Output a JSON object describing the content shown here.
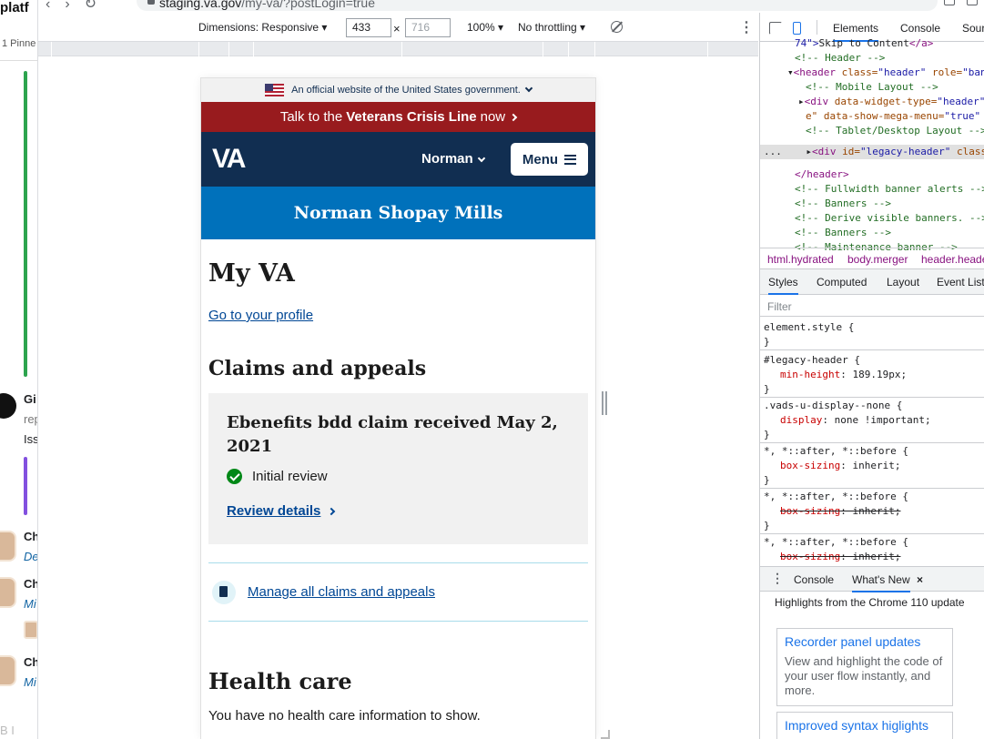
{
  "browser": {
    "url_host": "staging.va.gov",
    "url_path": "/my-va/?postLogin=true"
  },
  "left_app": {
    "title": "platf",
    "pinned": "1 Pinne",
    "item_g": "Gi",
    "item_rep": "rep",
    "item_iss": "Iss",
    "ch1": "Ch",
    "ch1_sub": "De",
    "ch2": "Ch",
    "ch2_sub": "Mi",
    "ch3": "Ch",
    "ch3_sub": "Mi",
    "bottom": "B  I"
  },
  "device_toolbar": {
    "dimensions_label": "Dimensions: Responsive ▾",
    "width_value": "433",
    "height_placeholder": "716",
    "times": "×",
    "zoom_label": "100% ▾",
    "throttle_label": "No throttling ▾"
  },
  "va_page": {
    "gov_banner": "An official website of the United States government.",
    "crisis_pre": "Talk to the",
    "crisis_bold": "Veterans Crisis Line",
    "crisis_post": "now",
    "logo": "VA",
    "user_menu": "Norman",
    "menu_button": "Menu",
    "name_band": "Norman Shopay Mills",
    "heading": "My VA",
    "profile_link": "Go to your profile",
    "claims_heading": "Claims and appeals",
    "claim_title": "Ebenefits bdd claim received May 2, 2021",
    "claim_status": "Initial review",
    "review_link": "Review details",
    "manage_link": "Manage all claims and appeals",
    "health_heading": "Health care",
    "health_text": "You have no health care information to show."
  },
  "devtools": {
    "tabs": [
      "Elements",
      "Console",
      "Sour"
    ],
    "dom_lines": {
      "l1_val": "74\">",
      "l1_txt": "Skip to Content",
      "l1_tag": "</a>",
      "l2": "<!-- Header -->",
      "l3_tag": "<header",
      "l3_attr1": " class=",
      "l3_val1": "\"header\"",
      "l3_attr2": " role=",
      "l3_val2": "\"ban",
      "l4": "<!-- Mobile Layout -->",
      "l5_tag": "<div",
      "l5_attr": " data-widget-type=",
      "l5_val": "\"header\"",
      "l6_attr": "e\" data-show-mega-menu=",
      "l6_val": "\"true\"",
      "l7": "<!-- Tablet/Desktop Layout -->",
      "l8_dots": "...",
      "l8_tag": "<div",
      "l8_attr1": " id=",
      "l8_val1": "\"legacy-header\"",
      "l8_attr2": " class=",
      "l9": "</header>",
      "l10": "<!-- Fullwidth banner alerts -->",
      "l11": "<!-- Banners -->",
      "l12": "<!-- Derive visible banners. -->",
      "l13": "<!-- Banners -->",
      "l14": "<!-- Maintenance banner -->"
    },
    "breadcrumbs": [
      "html.hydrated",
      "body.merger",
      "header.heade"
    ],
    "sub_tabs": [
      "Styles",
      "Computed",
      "Layout",
      "Event List"
    ],
    "filter_placeholder": "Filter",
    "styles": {
      "r1_sel": "element.style {",
      "r1_end": "}",
      "r2_sel": "#legacy-header {",
      "r2_prop": "min-height",
      "r2_val": ": 189.19px;",
      "r2_end": "}",
      "r3_sel": ".vads-u-display--none {",
      "r3_prop": "display",
      "r3_val": ": none !important;",
      "r3_end": "}",
      "r4_sel": "*, *::after, *::before {",
      "r4_prop": "box-sizing",
      "r4_val": ": inherit;",
      "r4_end": "}",
      "r5_sel": "*, *::after, *::before {",
      "r5_prop": "box-sizing",
      "r5_val": ": inherit;",
      "r5_end": "}",
      "r6_sel": "*, *::after, *::before {",
      "r6_prop": "box-sizing",
      "r6_val": ": inherit;"
    },
    "drawer_tabs": [
      "Console",
      "What's New"
    ],
    "drawer_close": "×",
    "highlights": "Highlights from the Chrome 110 update",
    "card1_title": "Recorder panel updates",
    "card1_body": "View and highlight the code of your user flow instantly, and more.",
    "card2_title": "Improved syntax higlights"
  },
  "colors": {
    "crisis_red": "#981b1e",
    "va_navy": "#112e51",
    "va_blue": "#0071bb",
    "link_blue": "#004795",
    "devtools_accent": "#1a73e8"
  }
}
